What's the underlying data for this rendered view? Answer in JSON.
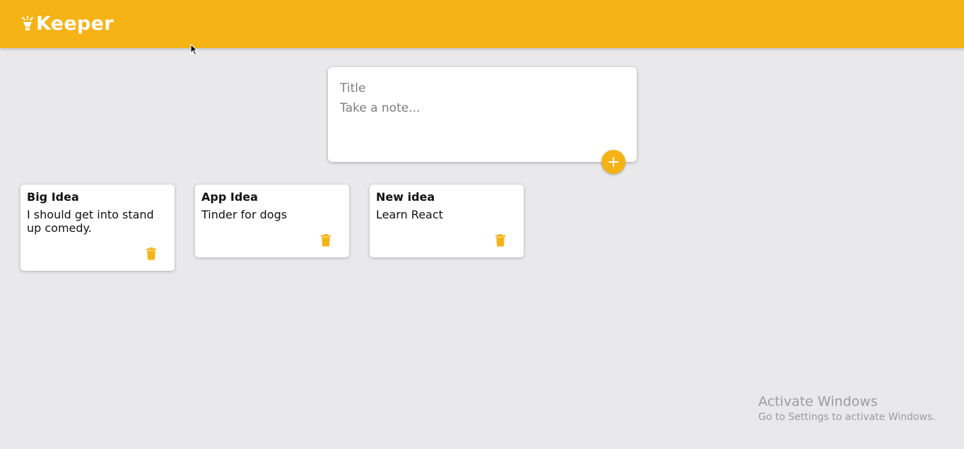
{
  "header": {
    "app_name": "Keeper",
    "logo_icon": "lightbulb-icon",
    "accent": "#f5b315"
  },
  "composer": {
    "title_placeholder": "Title",
    "content_placeholder": "Take a note...",
    "add_icon": "plus-icon"
  },
  "notes": [
    {
      "title": "Big Idea",
      "content": "I should get into stand\nup comedy.",
      "delete_icon": "trash-icon"
    },
    {
      "title": "App Idea",
      "content": "Tinder for dogs",
      "delete_icon": "trash-icon"
    },
    {
      "title": "New idea",
      "content": "Learn React",
      "delete_icon": "trash-icon"
    }
  ],
  "watermark": {
    "line1": "Activate Windows",
    "line2": "Go to Settings to activate Windows."
  }
}
